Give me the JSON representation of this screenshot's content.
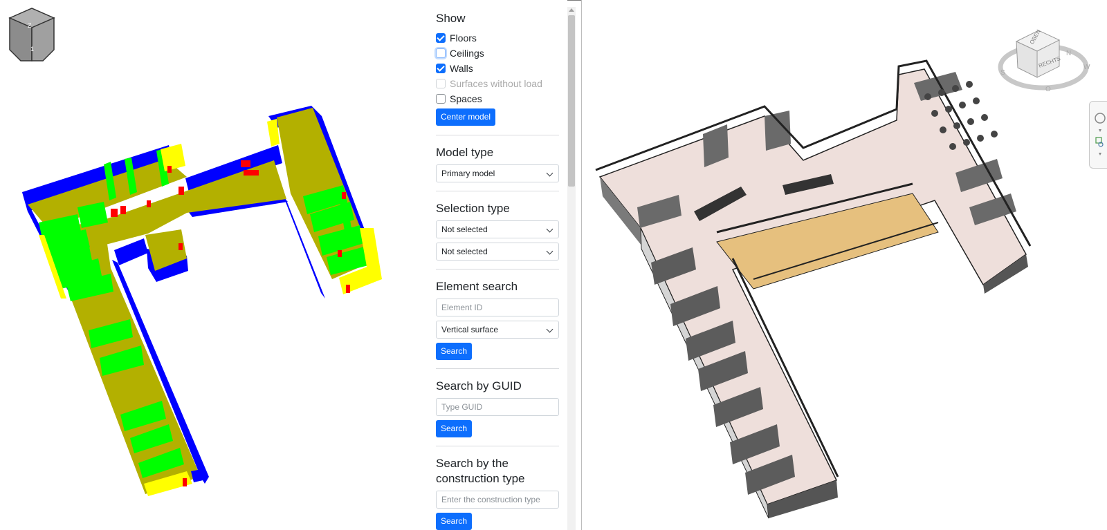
{
  "left_viewer": {
    "view_cube_labels": {
      "top": "Z",
      "front": "1"
    }
  },
  "panel": {
    "show": {
      "title": "Show",
      "items": [
        {
          "label": "Floors",
          "checked": true,
          "disabled": false
        },
        {
          "label": "Ceilings",
          "checked": false,
          "disabled": false
        },
        {
          "label": "Walls",
          "checked": true,
          "disabled": false
        },
        {
          "label": "Surfaces without load",
          "checked": false,
          "disabled": true
        },
        {
          "label": "Spaces",
          "checked": false,
          "disabled": false
        }
      ],
      "center_button": "Center model"
    },
    "model_type": {
      "title": "Model type",
      "selected": "Primary model"
    },
    "selection_type": {
      "title": "Selection type",
      "first_selected": "Not selected",
      "second_selected": "Not selected"
    },
    "element_search": {
      "title": "Element search",
      "id_placeholder": "Element ID",
      "surface_selected": "Vertical surface",
      "search_button": "Search"
    },
    "guid_search": {
      "title": "Search by GUID",
      "placeholder": "Type GUID",
      "search_button": "Search"
    },
    "construction_search": {
      "title_line1": "Search by the",
      "title_line2": "construction type",
      "placeholder": "Enter the construction type",
      "search_button": "Search"
    }
  },
  "right_viewer": {
    "view_cube_labels": {
      "top": "OBEN",
      "right": "RECHTS"
    },
    "compass_letters": [
      "N",
      "O",
      "S",
      "W"
    ]
  },
  "colors": {
    "accent": "#0d6efd",
    "floor": "#b3b000",
    "wall_exterior": "#0000ff",
    "wall_interior": "#00ff00",
    "wall_end": "#ffff00",
    "opening": "#ff0000",
    "atrium": "#e6c07e",
    "floor_right": "#eedfdb"
  }
}
